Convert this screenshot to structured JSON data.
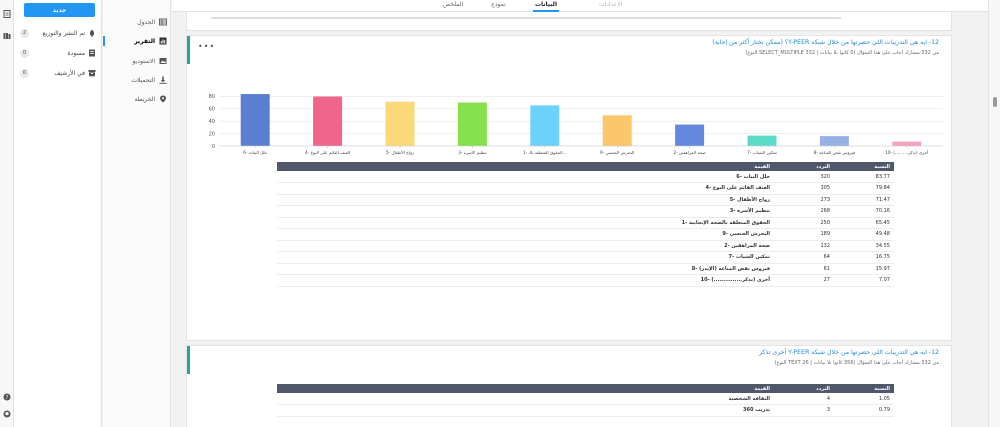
{
  "sidebar": {
    "new_label": "جديد",
    "items": [
      {
        "label": "تم النشر والتوزيع",
        "count": "2"
      },
      {
        "label": "مسودة",
        "count": "0"
      },
      {
        "label": "في الأرشيف",
        "count": "0"
      }
    ]
  },
  "subnav": {
    "items": [
      {
        "label": "الجدول"
      },
      {
        "label": "التقرير"
      },
      {
        "label": "الاستوديو"
      },
      {
        "label": "التحميلات"
      },
      {
        "label": "الخريطة"
      }
    ]
  },
  "tabs": [
    {
      "label": "الإعدادات"
    },
    {
      "label": "البيانات"
    },
    {
      "label": "نموذج"
    },
    {
      "label": "الملخص"
    }
  ],
  "q1": {
    "title": "12- ايه هي التدريبات اللي حضرتها من خلال شبكة Y-PEER؟ (ممكن تختار أكثر من إجابة)",
    "subtitle": "من 332 مشارك أجاب على هذا السؤال (0 كانوا بلا بيانات | SELECT_MULTIPLE 332 النوع)",
    "menu": "•••",
    "table_headers": {
      "label": "القيمة",
      "freq": "التردد",
      "pct": "النسبة"
    },
    "rows": [
      {
        "label": "6- خلل البنات",
        "freq": "320",
        "pct": "83.77"
      },
      {
        "label": "4- العنف القائم على النوع",
        "freq": "305",
        "pct": "79.84"
      },
      {
        "label": "5- زواج الأطفال",
        "freq": "273",
        "pct": "71.47"
      },
      {
        "label": "3- تنظيم الأسرة",
        "freq": "268",
        "pct": "70.16"
      },
      {
        "label": "1- الحقوق المتعلقة بالصحة الإنجابية",
        "freq": "250",
        "pct": "65.45"
      },
      {
        "label": "9- التحرش الجنسي",
        "freq": "189",
        "pct": "49.48"
      },
      {
        "label": "2- صحة المراهقين",
        "freq": "132",
        "pct": "34.55"
      },
      {
        "label": "7- تمكين الشباب",
        "freq": "64",
        "pct": "16.75"
      },
      {
        "label": "8- فيروس نقص المناعة (الإيدز)",
        "freq": "61",
        "pct": "15.97"
      },
      {
        "label": "10- أخرى (تذكر...............)",
        "freq": "27",
        "pct": "7.07"
      }
    ]
  },
  "q2": {
    "title": "12- ايه هي التدريبات اللي حضرتها من خلال شبكة Y-PEER أخرى تذكر",
    "subtitle": "من 332 مشارك أجاب على هذا السؤال (356 كانوا بلا بيانات | TEXT 26 النوع)",
    "table_headers": {
      "label": "القيمة",
      "freq": "التردد",
      "pct": "النسبة"
    },
    "rows": [
      {
        "label": "الثقافة الشخصية",
        "freq": "4",
        "pct": "1.05"
      },
      {
        "label": "تدريب 360",
        "freq": "3",
        "pct": "0.79"
      }
    ]
  },
  "chart_data": {
    "type": "bar",
    "categories": [
      "6- خلل البنات",
      "4- العنف القائم على النوع",
      "5- زواج الأطفال",
      "3- تنظيم الأسرة",
      "1- الحقوق المتعلقة بالـ...",
      "9- التحرش الجنسي",
      "2- صحة المراهقين",
      "7- تمكين الشباب",
      "8- فيروس نقص المناعة",
      "10- أخرى (تذكر..........)"
    ],
    "values": [
      83.77,
      79.84,
      71.47,
      70.16,
      65.45,
      49.48,
      34.55,
      16.75,
      15.97,
      7.07
    ],
    "colors": [
      "#5b7fd0",
      "#f0658c",
      "#fbd879",
      "#86e04e",
      "#6cd2fc",
      "#fac86b",
      "#6488de",
      "#5cdcc8",
      "#98b1e5",
      "#f6a4bd"
    ],
    "yticks": [
      0,
      20,
      40,
      60,
      80
    ],
    "ylim": [
      0,
      100
    ],
    "grid": true
  }
}
